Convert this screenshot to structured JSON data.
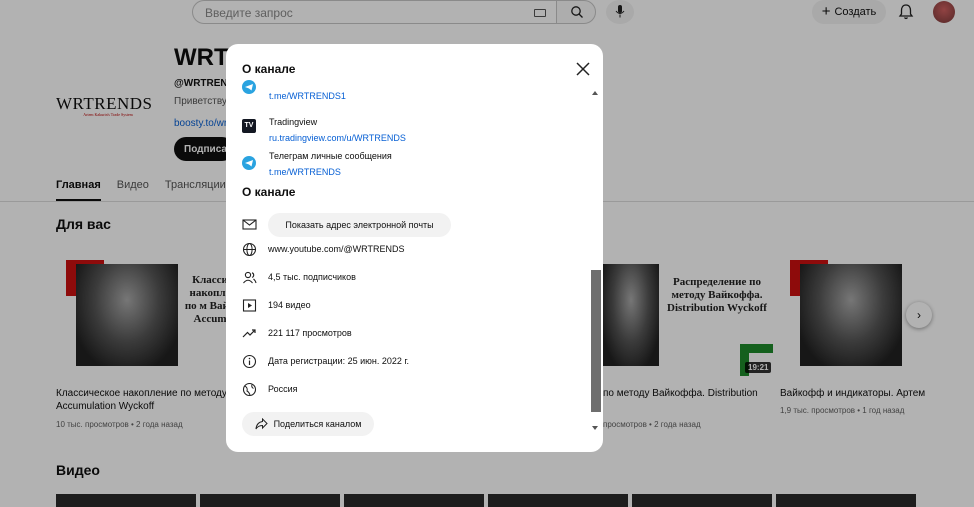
{
  "header": {
    "search_placeholder": "Введите запрос",
    "create_label": "Создать"
  },
  "channel": {
    "logo_text": "WRTRENDS",
    "logo_tagline": "Artem Kakurin's Trade System",
    "name": "WRT",
    "handle": "@WRTREND",
    "welcome": "Приветству",
    "link": "boosty.to/wr",
    "subscribe": "Подписат"
  },
  "tabs": [
    "Главная",
    "Видео",
    "Трансляции"
  ],
  "sections": {
    "for_you": "Для вас",
    "videos": "Видео"
  },
  "for_you_videos": [
    {
      "thumb_text": "Класси накопле по м Вайк Accum",
      "title_line1": "Классическое накопление по методу В",
      "title_line2": "Accumulation Wyckoff",
      "meta": "10 тыс. просмотров • 2 года назад"
    },
    {
      "thumb_text": "Распределение по методу Вайкоффа. Distribution Wyckoff",
      "duration": "19:21",
      "title_line1": "по методу Вайкоффа. Distribution",
      "meta": "просмотров • 2 года назад"
    },
    {
      "title_line1": "Вайкофф и индикаторы. Артем",
      "meta": "1,9 тыс. просмотров • 1 год назад"
    }
  ],
  "dialog": {
    "title": "О канале",
    "links": [
      {
        "name": "",
        "url": "t.me/WRTRENDS1",
        "icon": "telegram-icon"
      },
      {
        "name": "Tradingview",
        "url": "ru.tradingview.com/u/WRTRENDS",
        "icon": "tradingview-icon"
      },
      {
        "name": "Телеграм личные сообщения",
        "url": "t.me/WRTRENDS",
        "icon": "telegram-icon"
      }
    ],
    "about_heading": "О канале",
    "show_email": "Показать адрес электронной почты",
    "website": "www.youtube.com/@WRTRENDS",
    "subscribers": "4,5 тыс. подписчиков",
    "videos": "194 видео",
    "views": "221 117 просмотров",
    "registered": "Дата регистрации: 25 июн. 2022 г.",
    "country": "Россия",
    "share": "Поделиться каналом"
  },
  "colors": {
    "link": "#065fd4",
    "telegram": "#2aa3e0",
    "overlay": "rgba(0,0,0,0.3)"
  }
}
